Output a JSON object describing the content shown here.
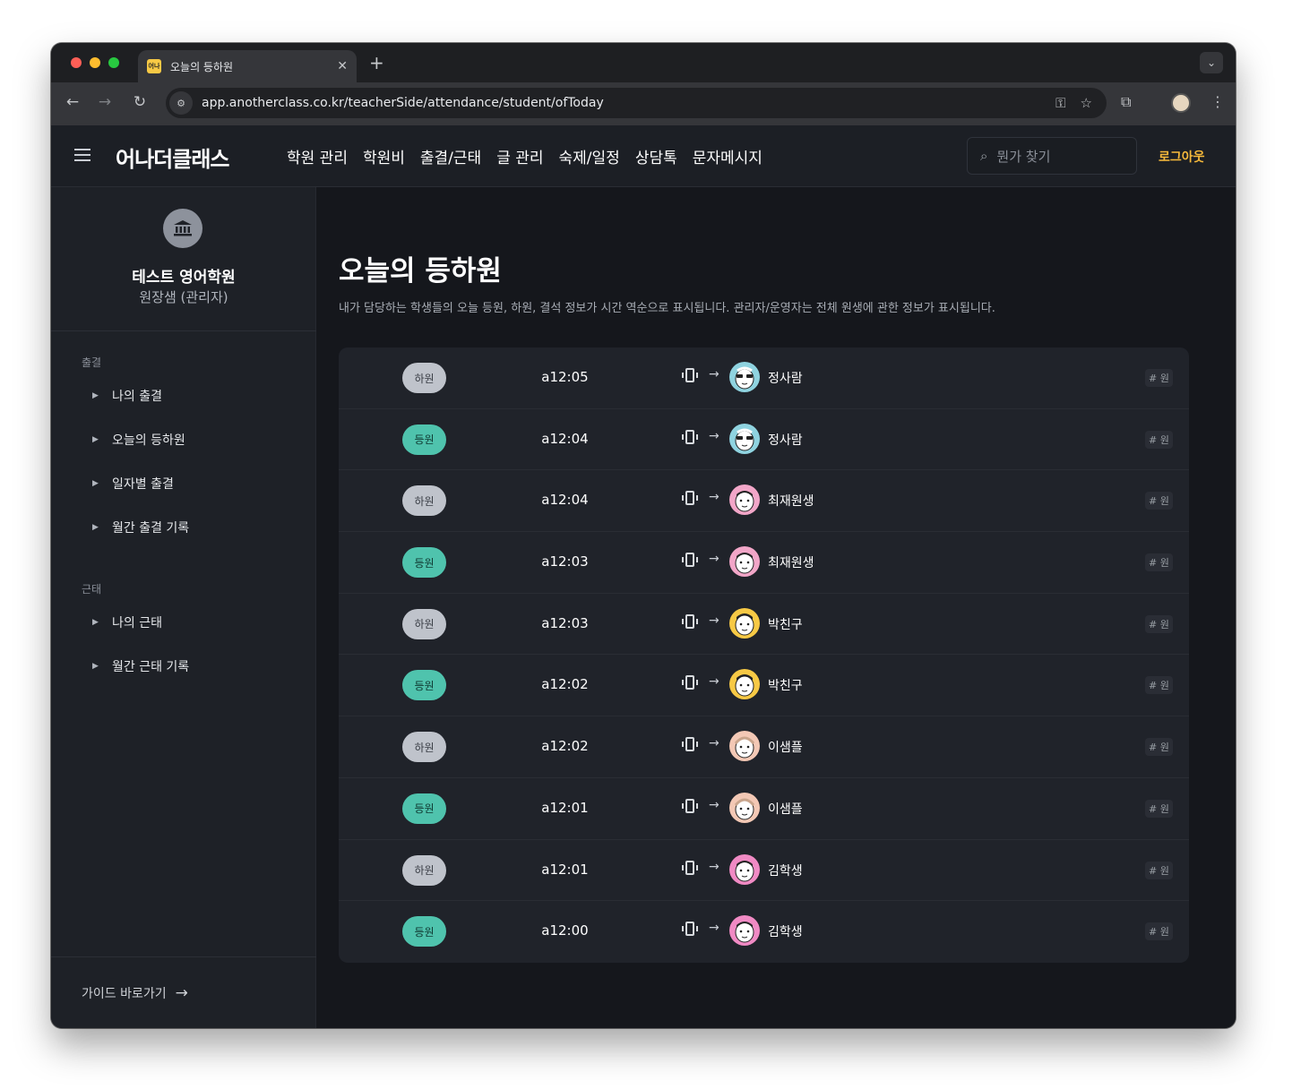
{
  "browser": {
    "tab_title": "오늘의 등하원",
    "tab_favicon_text": "어나",
    "url": "app.anotherclass.co.kr/teacherSide/attendance/student/ofToday"
  },
  "header": {
    "logo": "어나더클래스",
    "nav": [
      "학원 관리",
      "학원비",
      "출결/근태",
      "글 관리",
      "숙제/일정",
      "상담톡",
      "문자메시지"
    ],
    "search_placeholder": "뭔가 찾기",
    "logout": "로그아웃"
  },
  "sidebar": {
    "school_name": "테스트 영어학원",
    "role": "원장샘 (관리자)",
    "sections": [
      {
        "title": "출결",
        "items": [
          "나의 출결",
          "오늘의 등하원",
          "일자별 출결",
          "월간 출결 기록"
        ]
      },
      {
        "title": "근태",
        "items": [
          "나의 근태",
          "월간 근태 기록"
        ]
      }
    ],
    "guide_link": "가이드 바로가기"
  },
  "main": {
    "title": "오늘의 등하원",
    "description": "내가 담당하는 학생들의 오늘 등원, 하원, 결석 정보가 시간 역순으로 표시됩니다. 관리자/운영자는 전체 원생에 관한 정보가 표시됩니다.",
    "rows": [
      {
        "type": "하원",
        "kind": "out",
        "time": "a12:05",
        "name": "정사람",
        "tag": "# 원",
        "avatar": "sunglasses"
      },
      {
        "type": "등원",
        "kind": "in",
        "time": "a12:04",
        "name": "정사람",
        "tag": "# 원",
        "avatar": "sunglasses"
      },
      {
        "type": "하원",
        "kind": "out",
        "time": "a12:04",
        "name": "최재원생",
        "tag": "# 원",
        "avatar": "pink"
      },
      {
        "type": "등원",
        "kind": "in",
        "time": "a12:03",
        "name": "최재원생",
        "tag": "# 원",
        "avatar": "pink"
      },
      {
        "type": "하원",
        "kind": "out",
        "time": "a12:03",
        "name": "박친구",
        "tag": "# 원",
        "avatar": "yellow"
      },
      {
        "type": "등원",
        "kind": "in",
        "time": "a12:02",
        "name": "박친구",
        "tag": "# 원",
        "avatar": "yellow"
      },
      {
        "type": "하원",
        "kind": "out",
        "time": "a12:02",
        "name": "이샘플",
        "tag": "# 원",
        "avatar": "beige"
      },
      {
        "type": "등원",
        "kind": "in",
        "time": "a12:01",
        "name": "이샘플",
        "tag": "# 원",
        "avatar": "beige"
      },
      {
        "type": "하원",
        "kind": "out",
        "time": "a12:01",
        "name": "김학생",
        "tag": "# 원",
        "avatar": "magenta"
      },
      {
        "type": "등원",
        "kind": "in",
        "time": "a12:00",
        "name": "김학생",
        "tag": "# 원",
        "avatar": "magenta"
      }
    ]
  },
  "colors": {
    "badge_in": "#4fc3ad",
    "badge_out": "#bfc3cb",
    "logout": "#f6b93b",
    "avatar_sunglasses": "#8fd3e0",
    "avatar_pink": "#f2a6c8",
    "avatar_yellow": "#f7c945",
    "avatar_beige": "#f3c8b5",
    "avatar_magenta": "#f08ac4"
  },
  "icons": {
    "device": "phone-checkin-icon",
    "arrow": "arrow-right-icon",
    "school": "bank-icon"
  }
}
